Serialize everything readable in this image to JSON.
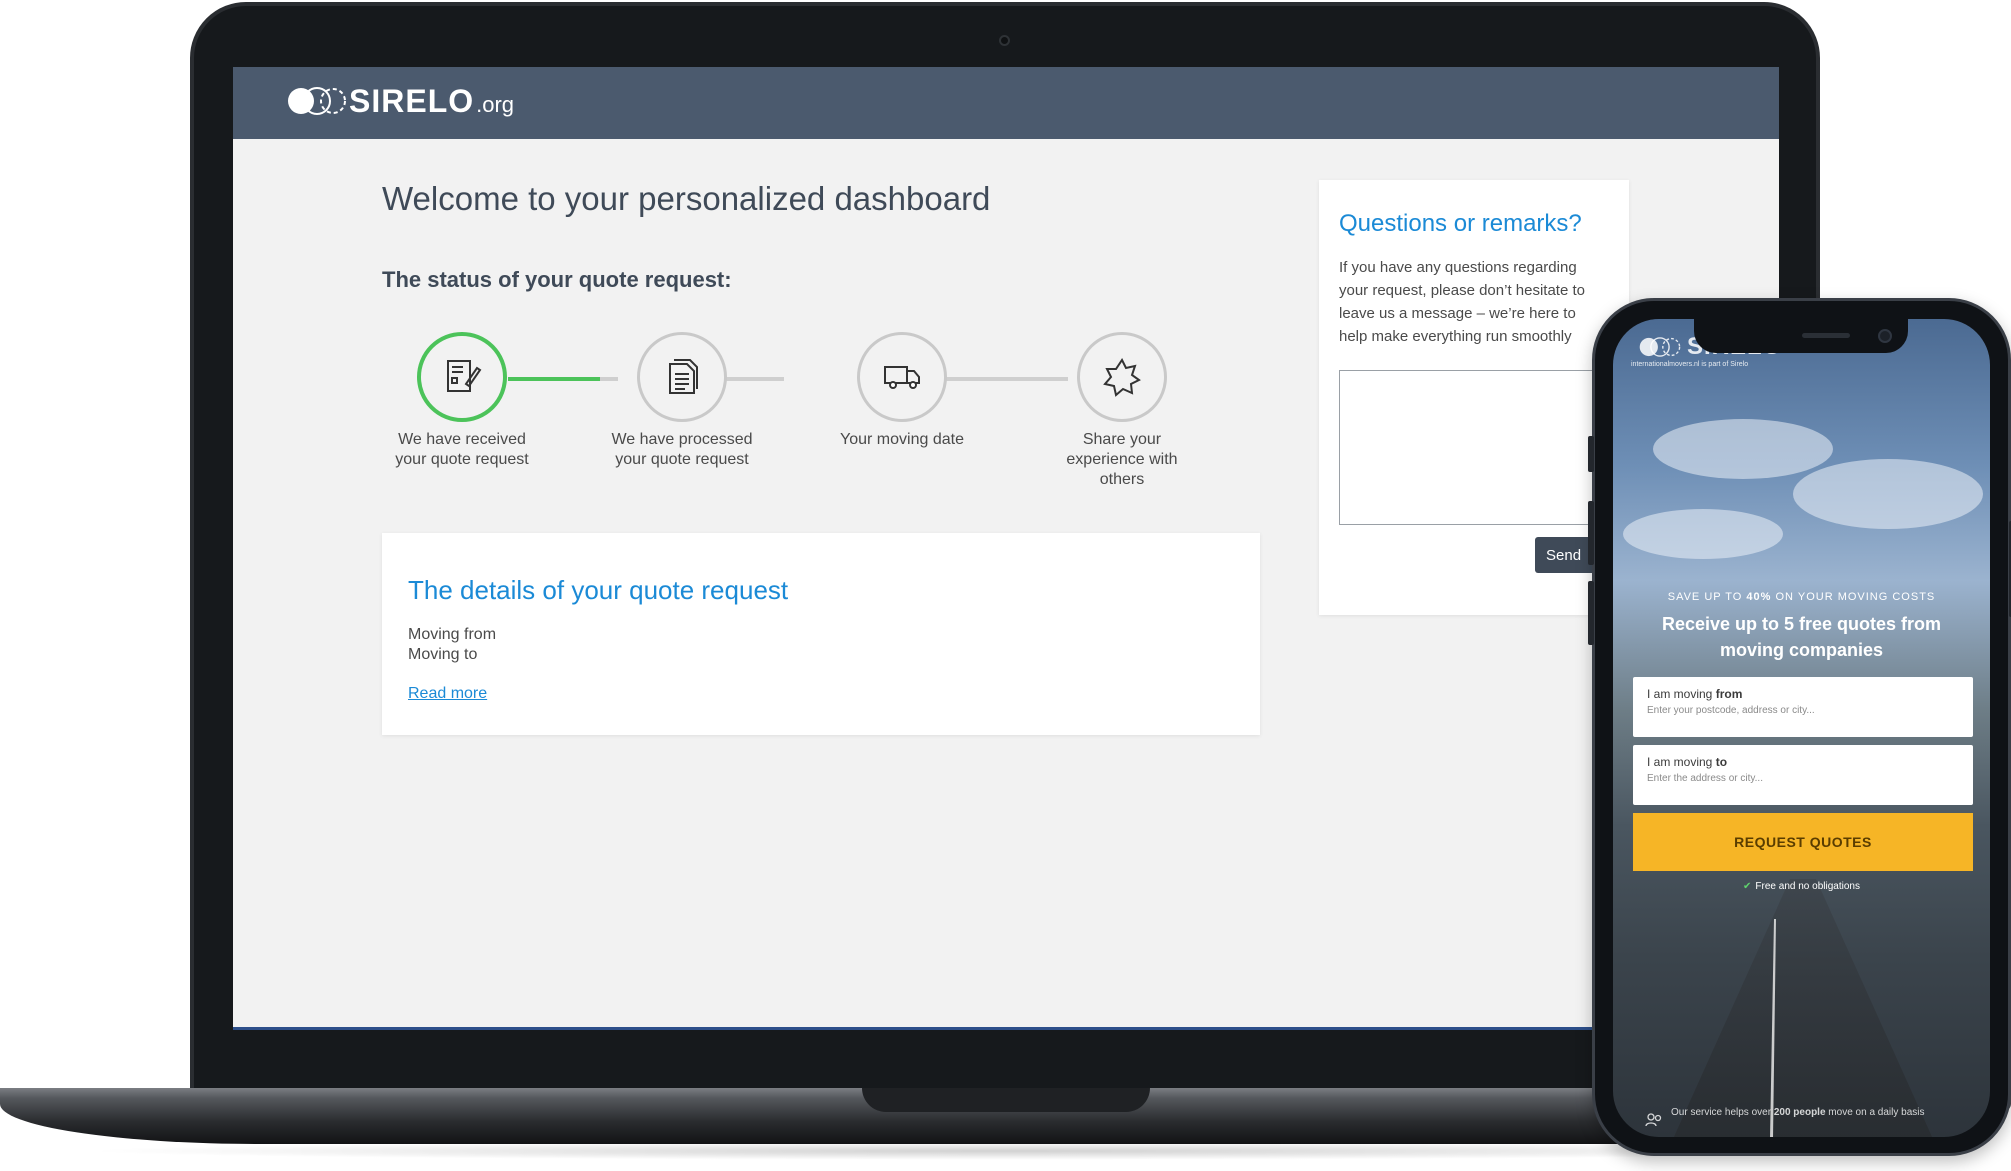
{
  "laptop": {
    "header": {
      "logo_text": "SIRELO",
      "logo_suffix": ".org"
    },
    "page_title": "Welcome to your personalized dashboard",
    "status_title": "The status of your quote request:",
    "steps": [
      {
        "label_line1": "We have received",
        "label_line2": "your quote request",
        "label_line3": "",
        "icon": "form-edit-icon",
        "active": true
      },
      {
        "label_line1": "We have processed",
        "label_line2": "your quote request",
        "label_line3": "",
        "icon": "document-icon",
        "active": false
      },
      {
        "label_line1": "Your moving date",
        "label_line2": "",
        "label_line3": "",
        "icon": "truck-icon",
        "active": false
      },
      {
        "label_line1": "Share your",
        "label_line2": "experience with",
        "label_line3": "others",
        "icon": "star-badge-icon",
        "active": false
      }
    ],
    "details": {
      "title": "The details of your quote request",
      "moving_from": "Moving from",
      "moving_to": "Moving to",
      "read_more": "Read more"
    },
    "questions": {
      "title": "Questions or remarks?",
      "text_line1": "If you have any questions regarding",
      "text_line2": "your request, please don’t hesitate to",
      "text_line3": "leave us a message – we’re here to",
      "text_line4": "help make everything run smoothly",
      "send_label": "Send"
    },
    "colors": {
      "header_bg": "#4b5a6e",
      "accent_blue": "#1b8ad6",
      "active_green": "#4cc35a"
    }
  },
  "phone": {
    "logo_text": "SIRELO",
    "sub_text": "internationalmovers.nl is part of Sirelo",
    "save_prefix": "SAVE UP TO ",
    "save_bold": "40%",
    "save_suffix": " ON YOUR MOVING COSTS",
    "headline_line1": "Receive up to 5 free quotes from",
    "headline_line2": "moving companies",
    "from_label_prefix": "I am moving ",
    "from_label_bold": "from",
    "from_placeholder": "Enter your postcode, address or city...",
    "to_label_prefix": "I am moving ",
    "to_label_bold": "to",
    "to_placeholder": "Enter the address or city...",
    "cta_label": "REQUEST QUOTES",
    "free_text": "Free and no obligations",
    "bottom_prefix": "Our service helps over ",
    "bottom_bold": "200 people",
    "bottom_suffix": " move on a daily basis",
    "colors": {
      "cta": "#f6b526"
    }
  }
}
